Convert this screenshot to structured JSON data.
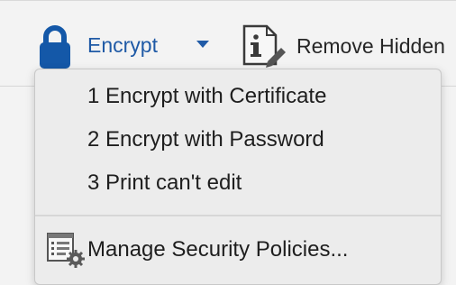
{
  "toolbar": {
    "encrypt": {
      "label": "Encrypt",
      "icon": "lock-icon",
      "dropdown_icon": "caret-down-icon",
      "accent_color": "#1f5aa6"
    },
    "remove_hidden": {
      "label": "Remove Hidden",
      "icon": "document-info-icon"
    }
  },
  "menu": {
    "items": [
      {
        "label": "1 Encrypt with Certificate"
      },
      {
        "label": "2 Encrypt with Password"
      },
      {
        "label": "3 Print can't edit"
      }
    ],
    "footer_item": {
      "label": "Manage Security Policies...",
      "icon": "security-policies-icon"
    }
  }
}
